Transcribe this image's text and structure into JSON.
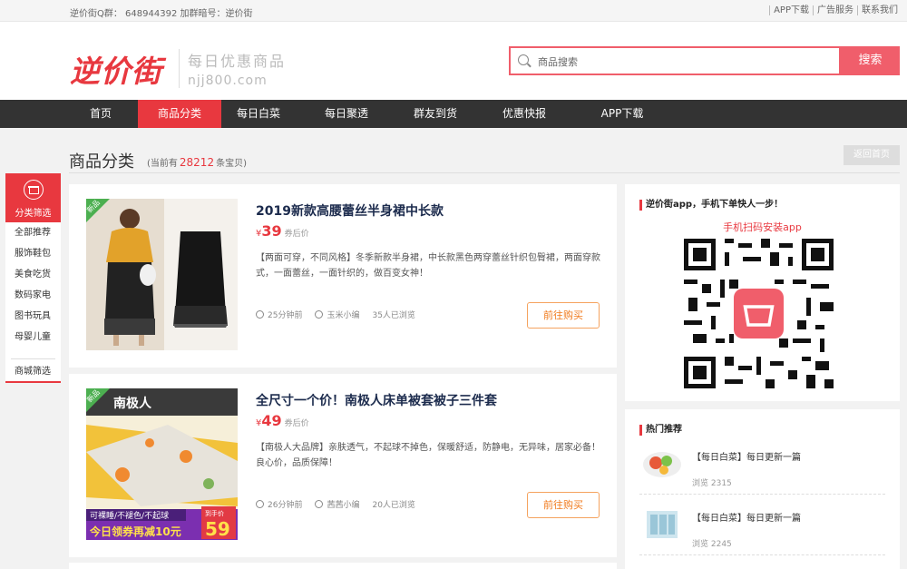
{
  "topbar": {
    "group": "逆价街Q群： 648944392 加群暗号：逆价街",
    "links": [
      "APP下载",
      "广告服务",
      "联系我们"
    ]
  },
  "logo": {
    "name": "逆价街",
    "slogan": "每日优惠商品",
    "domain": "njj800.com"
  },
  "search": {
    "placeholder": "商品搜索",
    "button": "搜索"
  },
  "nav": [
    {
      "label": "首页",
      "active": false
    },
    {
      "label": "商品分类",
      "active": true
    },
    {
      "label": "每日白菜",
      "active": false
    },
    {
      "label": "每日聚透",
      "active": false
    },
    {
      "label": "群友到货",
      "active": false
    },
    {
      "label": "优惠快报",
      "active": false
    },
    {
      "label": "APP下载",
      "active": false
    }
  ],
  "page": {
    "title": "商品分类",
    "count_prefix": "(当前有",
    "count": "28212",
    "count_suffix": "条宝贝)",
    "back": "返回首页"
  },
  "sidebar": {
    "title": "分类筛选",
    "items": [
      "全部推荐",
      "服饰鞋包",
      "美食吃货",
      "数码家电",
      "图书玩具",
      "母婴儿童"
    ],
    "mall": "商城筛选"
  },
  "products": [
    {
      "tag": "新品",
      "title": "2019新款高腰蕾丝半身裙中长款",
      "currency": "¥",
      "price": "39",
      "price_label": "券后价",
      "desc": "【两面可穿，不同风格】冬季新款半身裙，中长款黑色两穿蕾丝针织包臀裙，两面穿款式，一面蕾丝，一面针织的，做百变女神！",
      "time": "25分钟前",
      "author": "玉米小编",
      "views": "35人已浏览",
      "buy": "前往购买"
    },
    {
      "tag": "新品",
      "title": "全尺寸一个价！南极人床单被套被子三件套",
      "currency": "¥",
      "price": "49",
      "price_label": "券后价",
      "desc": "【南极人大品牌】亲肤透气，不起球不掉色，保暖舒适，防静电，无异味，居家必备！良心价，品质保障！",
      "time": "26分钟前",
      "author": "茜茜小编",
      "views": "20人已浏览",
      "buy": "前往购买",
      "img_text": {
        "brand": "南极人",
        "line1": "可裸睡/不褪色/不起球",
        "line2": "今日领券再减10元",
        "price_tag": "到手价",
        "price": "59"
      }
    }
  ],
  "app": {
    "title": "逆价街app，手机下单快人一步！",
    "sub": "手机扫码安装app",
    "qr_label": "逆价街"
  },
  "hot": {
    "title": "热门推荐",
    "items": [
      {
        "title": "【每日白菜】每日更新一篇",
        "views": "浏览 2315"
      },
      {
        "title": "【每日白菜】每日更新一篇",
        "views": "浏览 2245"
      }
    ]
  },
  "colors": {
    "brand": "#e8383f",
    "nav_bg": "#333333",
    "buy": "#f07a1c"
  }
}
